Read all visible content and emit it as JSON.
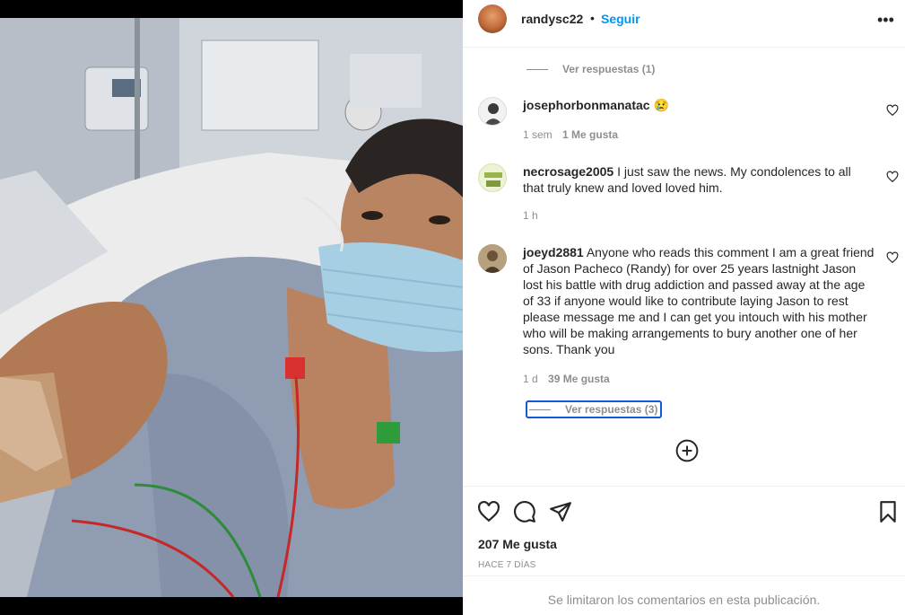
{
  "post": {
    "username": "randysc22",
    "separator": "•",
    "follow_label": "Seguir",
    "more_icon": "more-horizontal-icon"
  },
  "replies_top": {
    "label": "Ver respuestas (1)"
  },
  "comments": [
    {
      "username": "josephorbonmanatac",
      "text": "😢",
      "time": "1 sem",
      "likes": "1 Me gusta"
    },
    {
      "username": "necrosage2005",
      "text": "I just saw the news. My condolences to all that truly knew and loved loved him.",
      "time": "1 h",
      "likes": ""
    },
    {
      "username": "joeyd2881",
      "text": "Anyone who reads this comment I am a great friend of Jason Pacheco (Randy) for over 25 years lastnight Jason lost his battle with drug addiction and passed away at the age of 33 if anyone would like to contribute laying Jason to rest please message me and I can get you intouch with his mother who will be making arrangements to bury another one of her sons. Thank you",
      "time": "1 d",
      "likes": "39 Me gusta"
    }
  ],
  "replies_bottom": {
    "label": "Ver respuestas (3)"
  },
  "footer": {
    "likes_total": "207 Me gusta",
    "time_ago": "HACE 7 DÍAS",
    "comments_limited": "Se limitaron los comentarios en esta publicación."
  },
  "colors": {
    "link_blue": "#0095f6",
    "muted": "#8e8e8e",
    "text": "#262626",
    "focus": "#1a57d6"
  }
}
